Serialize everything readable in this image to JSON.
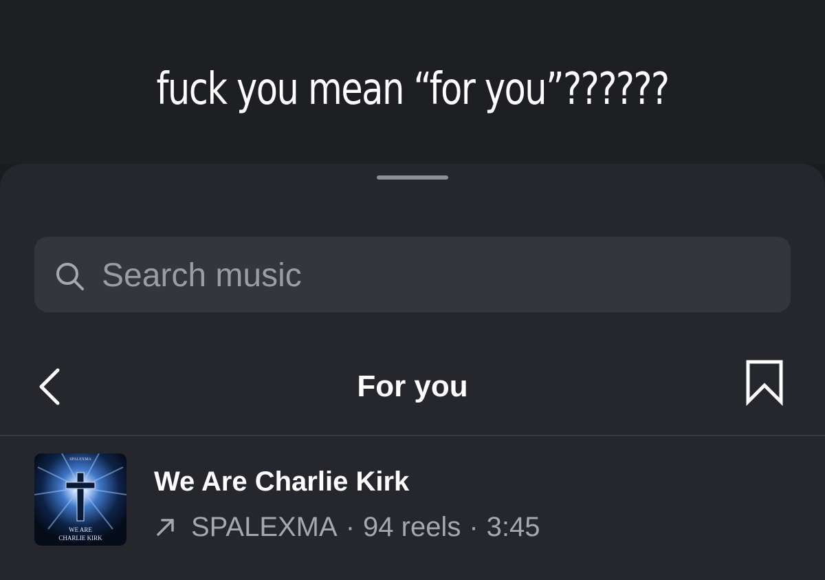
{
  "caption": {
    "text": "fuck you mean “for you”??????"
  },
  "search": {
    "placeholder": "Search music",
    "value": ""
  },
  "header": {
    "title": "For you"
  },
  "track": {
    "title": "We Are Charlie Kirk",
    "artist": "SPALEXMA",
    "reels": "94 reels",
    "duration": "3:45",
    "separator": "·",
    "art": {
      "top_text": "SPALEXMA",
      "line1": "WE ARE",
      "line2": "CHARLIE KIRK"
    }
  },
  "icons": {
    "search": "search-icon",
    "back": "chevron-left-icon",
    "trending": "arrow-up-right-icon",
    "bookmark": "bookmark-icon"
  },
  "colors": {
    "background": "#1b1c20",
    "sheet": "#26272c",
    "search_field": "#34363c",
    "primary_text": "#ffffff",
    "secondary_text": "#a6a8ad"
  }
}
